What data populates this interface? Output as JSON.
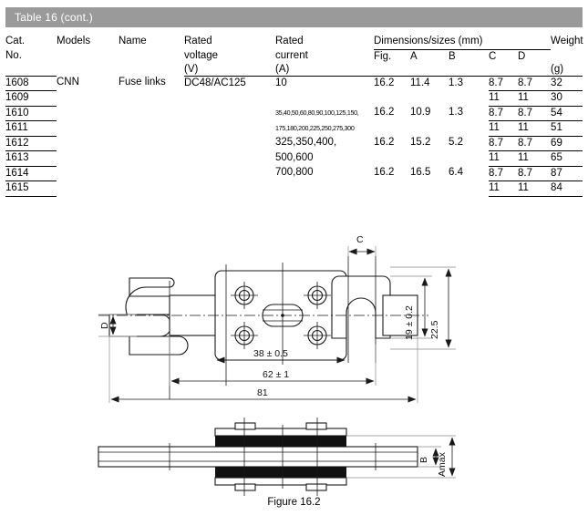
{
  "caption": {
    "title": "Table 16 (cont.)"
  },
  "table": {
    "headers": {
      "cat_no_l1": "Cat.",
      "cat_no_l2": "No.",
      "models": "Models",
      "name": "Name",
      "rated_voltage_l1": "Rated",
      "rated_voltage_l2": "voltage",
      "rated_voltage_l3": "(V)",
      "rated_current_l1": "Rated",
      "rated_current_l2": "current",
      "rated_current_l3": "(A)",
      "dimensions_group": "Dimensions/sizes (mm)",
      "fig": "Fig.",
      "a": "A",
      "b": "B",
      "c": "C",
      "d": "D",
      "weight": "Weight",
      "weight_unit": "(g)"
    },
    "rows": [
      {
        "cat_no": "1608",
        "models": "CNN",
        "name": "Fuse links",
        "rated_voltage": "DC48/AC125",
        "rated_current": "10",
        "fig": "16.2",
        "a": "11.4",
        "b": "1.3",
        "c": "8.7",
        "d": "8.7",
        "weight": "32"
      },
      {
        "cat_no": "1609",
        "models": "",
        "name": "",
        "rated_voltage": "",
        "rated_current": "",
        "fig": "",
        "a": "",
        "b": "",
        "c": "11",
        "d": "11",
        "weight": "30"
      },
      {
        "cat_no": "1610",
        "models": "",
        "name": "",
        "rated_voltage": "",
        "rated_current": "35,40,50,60,80,90,100,125,150,",
        "fig": "16.2",
        "a": "10.9",
        "b": "1.3",
        "c": "8.7",
        "d": "8.7",
        "weight": "54"
      },
      {
        "cat_no": "1611",
        "models": "",
        "name": "",
        "rated_voltage": "",
        "rated_current": "175,180,200,225,250,275,300",
        "fig": "",
        "a": "",
        "b": "",
        "c": "11",
        "d": "11",
        "weight": "51"
      },
      {
        "cat_no": "1612",
        "models": "",
        "name": "",
        "rated_voltage": "",
        "rated_current": "325,350,400,",
        "fig": "16.2",
        "a": "15.2",
        "b": "5.2",
        "c": "8.7",
        "d": "8.7",
        "weight": "69"
      },
      {
        "cat_no": "1613",
        "models": "",
        "name": "",
        "rated_voltage": "",
        "rated_current": "500,600",
        "fig": "",
        "a": "",
        "b": "",
        "c": "11",
        "d": "11",
        "weight": "65"
      },
      {
        "cat_no": "1614",
        "models": "",
        "name": "",
        "rated_voltage": "",
        "rated_current": "700,800",
        "fig": "16.2",
        "a": "16.5",
        "b": "6.4",
        "c": "8.7",
        "d": "8.7",
        "weight": "87"
      },
      {
        "cat_no": "1615",
        "models": "",
        "name": "",
        "rated_voltage": "",
        "rated_current": "",
        "fig": "",
        "a": "",
        "b": "",
        "c": "11",
        "d": "11",
        "weight": "84"
      }
    ]
  },
  "figure": {
    "caption": "Figure 16.2",
    "dimensions": {
      "d_label": "D",
      "c_label": "C",
      "b_label": "B",
      "amax_label": "Amax",
      "height_19": "19 ± 0.2",
      "height_225": "22.5",
      "len_38": "38 ± 0.5",
      "len_62": "62 ± 1",
      "len_81": "81"
    }
  },
  "colors": {
    "caption_bar": "#9a9a9a",
    "caption_text": "#ffffff",
    "line": "#000000",
    "page": "#ffffff"
  }
}
